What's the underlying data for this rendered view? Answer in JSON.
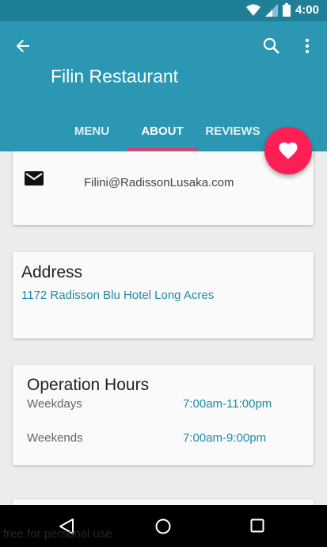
{
  "status_bar": {
    "time": "4:00"
  },
  "app_bar": {
    "title": "Filin Restaurant",
    "icons": {
      "back": "arrow-back-icon",
      "search": "search-icon",
      "more": "more-vert-icon"
    }
  },
  "tabs": [
    {
      "label": "MENU",
      "selected": false
    },
    {
      "label": "ABOUT",
      "selected": true
    },
    {
      "label": "REVIEWS",
      "selected": false
    }
  ],
  "fab": {
    "icon": "heart-icon"
  },
  "contact": {
    "email": "Filini@RadissonLusaka.com",
    "icon": "mail-icon"
  },
  "address": {
    "title": "Address",
    "value": "1172 Radisson Blu Hotel Long Acres"
  },
  "hours": {
    "title": "Operation Hours",
    "rows": [
      {
        "day": "Weekdays",
        "time": "7:00am-11:00pm"
      },
      {
        "day": "Weekends",
        "time": "7:00am-9:00pm"
      }
    ]
  },
  "watermark": "free for personal use",
  "colors": {
    "status_bar": "#1f7f97",
    "app_bar": "#2b97b3",
    "accent": "#ff1f54",
    "link": "#1e8aa6"
  }
}
